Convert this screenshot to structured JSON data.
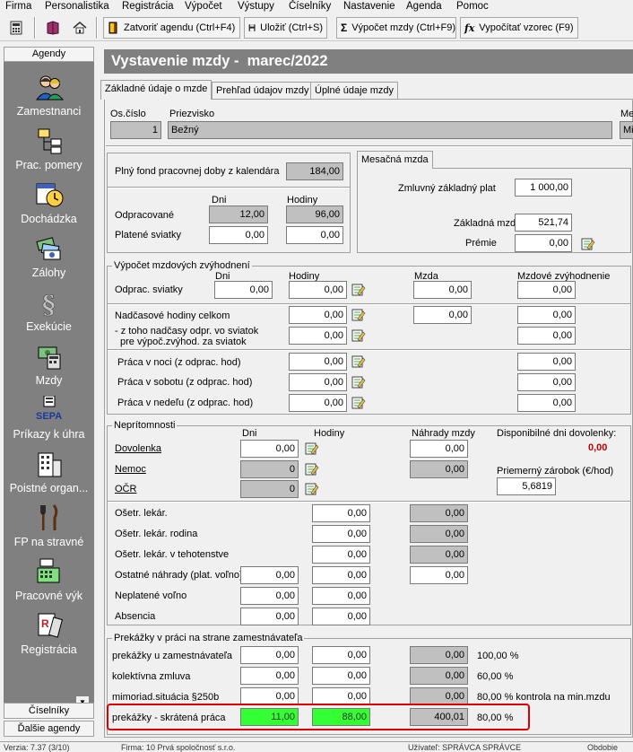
{
  "menu": [
    "Firma",
    "Personalistika",
    "Registrácia",
    "Výpočet",
    "Výstupy",
    "Číselníky",
    "Nastavenie",
    "Agenda",
    "Pomoc"
  ],
  "toolbar": {
    "new_agenda": "Zatvoriť agendu (Ctrl+F4)",
    "save": "Uložiť (Ctrl+S)",
    "calc_wage": "Výpočet mzdy (Ctrl+F9)",
    "calc_formula": "Vypočítať vzorec (F9)",
    "sigma_glyph": "Σ",
    "fx_glyph": "fx"
  },
  "sidebar": {
    "header": "Agendy",
    "items": [
      {
        "label": "Zamestnanci",
        "icon": "people-icon"
      },
      {
        "label": "Prac. pomery",
        "icon": "org-chart-icon"
      },
      {
        "label": "Dochádzka",
        "icon": "attendance-clock-icon"
      },
      {
        "label": "Zálohy",
        "icon": "banknotes-icon"
      },
      {
        "label": "Exekúcie",
        "icon": "paragraph-seal-icon"
      },
      {
        "label": "Mzdy",
        "icon": "money-calculator-icon"
      },
      {
        "label": "Príkazy k úhra",
        "icon": "sepa-icon"
      },
      {
        "label": "Poistné organ...",
        "icon": "building-icon"
      },
      {
        "label": "FP na stravné",
        "icon": "cutlery-icon"
      },
      {
        "label": "Pracovné výk",
        "icon": "cash-register-icon"
      },
      {
        "label": "Registrácia",
        "icon": "document-stamp-icon"
      }
    ],
    "sepa_text": "SEPA",
    "footer1": "Číselníky",
    "footer2": "Ďalšie agendy"
  },
  "title": "Vystavenie mzdy -  marec/2022",
  "tabs": [
    "Základné údaje o mzde",
    "Prehľad údajov mzdy",
    "Úplné údaje mzdy"
  ],
  "employee": {
    "os_cislo_label": "Os.číslo",
    "os_cislo": "1",
    "priezvisko_label": "Priezvisko",
    "priezvisko": "Bežný",
    "me_label": "Me",
    "me_value": "Mi"
  },
  "fond": {
    "label": "Plný fond pracovnej doby z kalendára",
    "value": "184,00",
    "dni": "Dni",
    "hodiny": "Hodiny",
    "odprac_label": "Odpracované",
    "odprac_dni": "12,00",
    "odprac_hod": "96,00",
    "platene_label": "Platené sviatky",
    "platene_dni": "0,00",
    "platene_hod": "0,00"
  },
  "mesacna": {
    "tab": "Mesačná mzda",
    "zmluvny_label": "Zmluvný základný plat",
    "zmluvny": "1 000,00",
    "zakladna_label": "Základná mzda",
    "zakladna": "521,74",
    "premie_label": "Prémie",
    "premie": "0,00"
  },
  "zvyhodnenia": {
    "title": "Výpočet mzdových zvýhodnení",
    "col_dni": "Dni",
    "col_hod": "Hodiny",
    "col_mzda": "Mzda",
    "col_zvyh": "Mzdové zvýhodnenie",
    "odprac_sviatky_label": "Odprac. sviatky",
    "odprac_sviatky_dni": "0,00",
    "odprac_sviatky_hod": "0,00",
    "odprac_sviatky_mzda": "0,00",
    "odprac_sviatky_zvyh": "0,00",
    "nadcas_label": "Nadčasové hodiny celkom",
    "nadcas_hod": "0,00",
    "nadcas_mzda": "0,00",
    "nadcas_zvyh": "0,00",
    "ztoho_label1": "- z toho nadčasy odpr. vo sviatok",
    "ztoho_label2": "pre výpoč.zvýhod. za sviatok",
    "ztoho_hod": "0,00",
    "ztoho_zvyh": "0,00",
    "noc_label": "Práca v noci (z odprac. hod)",
    "noc_hod": "0,00",
    "noc_zvyh": "0,00",
    "sobota_label": "Práca v sobotu (z odprac. hod)",
    "sobota_hod": "0,00",
    "sobota_zvyh": "0,00",
    "nedela_label": "Práca v nedeľu (z odprac. hod)",
    "nedela_hod": "0,00",
    "nedela_zvyh": "0,00"
  },
  "nepritomnosti": {
    "title": "Neprítomnosti",
    "col_dni": "Dni",
    "col_hod": "Hodiny",
    "col_nahrady": "Náhrady mzdy",
    "disp_label": "Disponibilné dni dovolenky:",
    "disp_value": "0,00",
    "priem_label": "Priemerný zárobok (€/hod)",
    "priem_value": "5,6819",
    "dovolenka_label": "Dovolenka",
    "dovolenka_dni": "0,00",
    "dovolenka_nahr": "0,00",
    "nemoc_label": "Nemoc",
    "nemoc_dni": "0",
    "nemoc_nahr": "0,00",
    "ocr_label": "OČR",
    "ocr_dni": "0",
    "osetr_lekar_label": "Ošetr. lekár.",
    "osetr_lekar_hod": "0,00",
    "osetr_lekar_nahr": "0,00",
    "osetr_rodina_label": "Ošetr. lekár. rodina",
    "osetr_rodina_hod": "0,00",
    "osetr_rodina_nahr": "0,00",
    "osetr_tehot_label": "Ošetr. lekár. v tehotenstve",
    "osetr_tehot_hod": "0,00",
    "osetr_tehot_nahr": "0,00",
    "ostatne_label": "Ostatné náhrady (plat. voľno)",
    "ostatne_dni": "0,00",
    "ostatne_hod": "0,00",
    "ostatne_nahr": "0,00",
    "neplatene_label": "Neplatené voľno",
    "neplatene_dni": "0,00",
    "neplatene_hod": "0,00",
    "absencia_label": "Absencia",
    "absencia_dni": "0,00",
    "absencia_hod": "0,00"
  },
  "prekazky": {
    "title": "Prekážky v práci na strane zamestnávateľa",
    "rows": [
      {
        "label": "prekážky u zamestnávateľa",
        "dni": "0,00",
        "hod": "0,00",
        "nahr": "0,00",
        "pct": "100,00 %"
      },
      {
        "label": "kolektívna zmluva",
        "dni": "0,00",
        "hod": "0,00",
        "nahr": "0,00",
        "pct": "60,00 %"
      },
      {
        "label": "mimoriad.situácia §250b",
        "dni": "0,00",
        "hod": "0,00",
        "nahr": "0,00",
        "pct": "80,00 % kontrola na min.mzdu"
      },
      {
        "label": "prekážky - skrátená práca",
        "dni": "11,00",
        "hod": "88,00",
        "nahr": "400,01",
        "pct": "80,00 %"
      }
    ]
  },
  "status": [
    "Verzia: 7.37 (3/10)",
    "Firma: 10 Prvá spoločnosť s.r.o.",
    "Užívateľ: SPRÁVCA SPRÁVCE",
    "Obdobie"
  ]
}
